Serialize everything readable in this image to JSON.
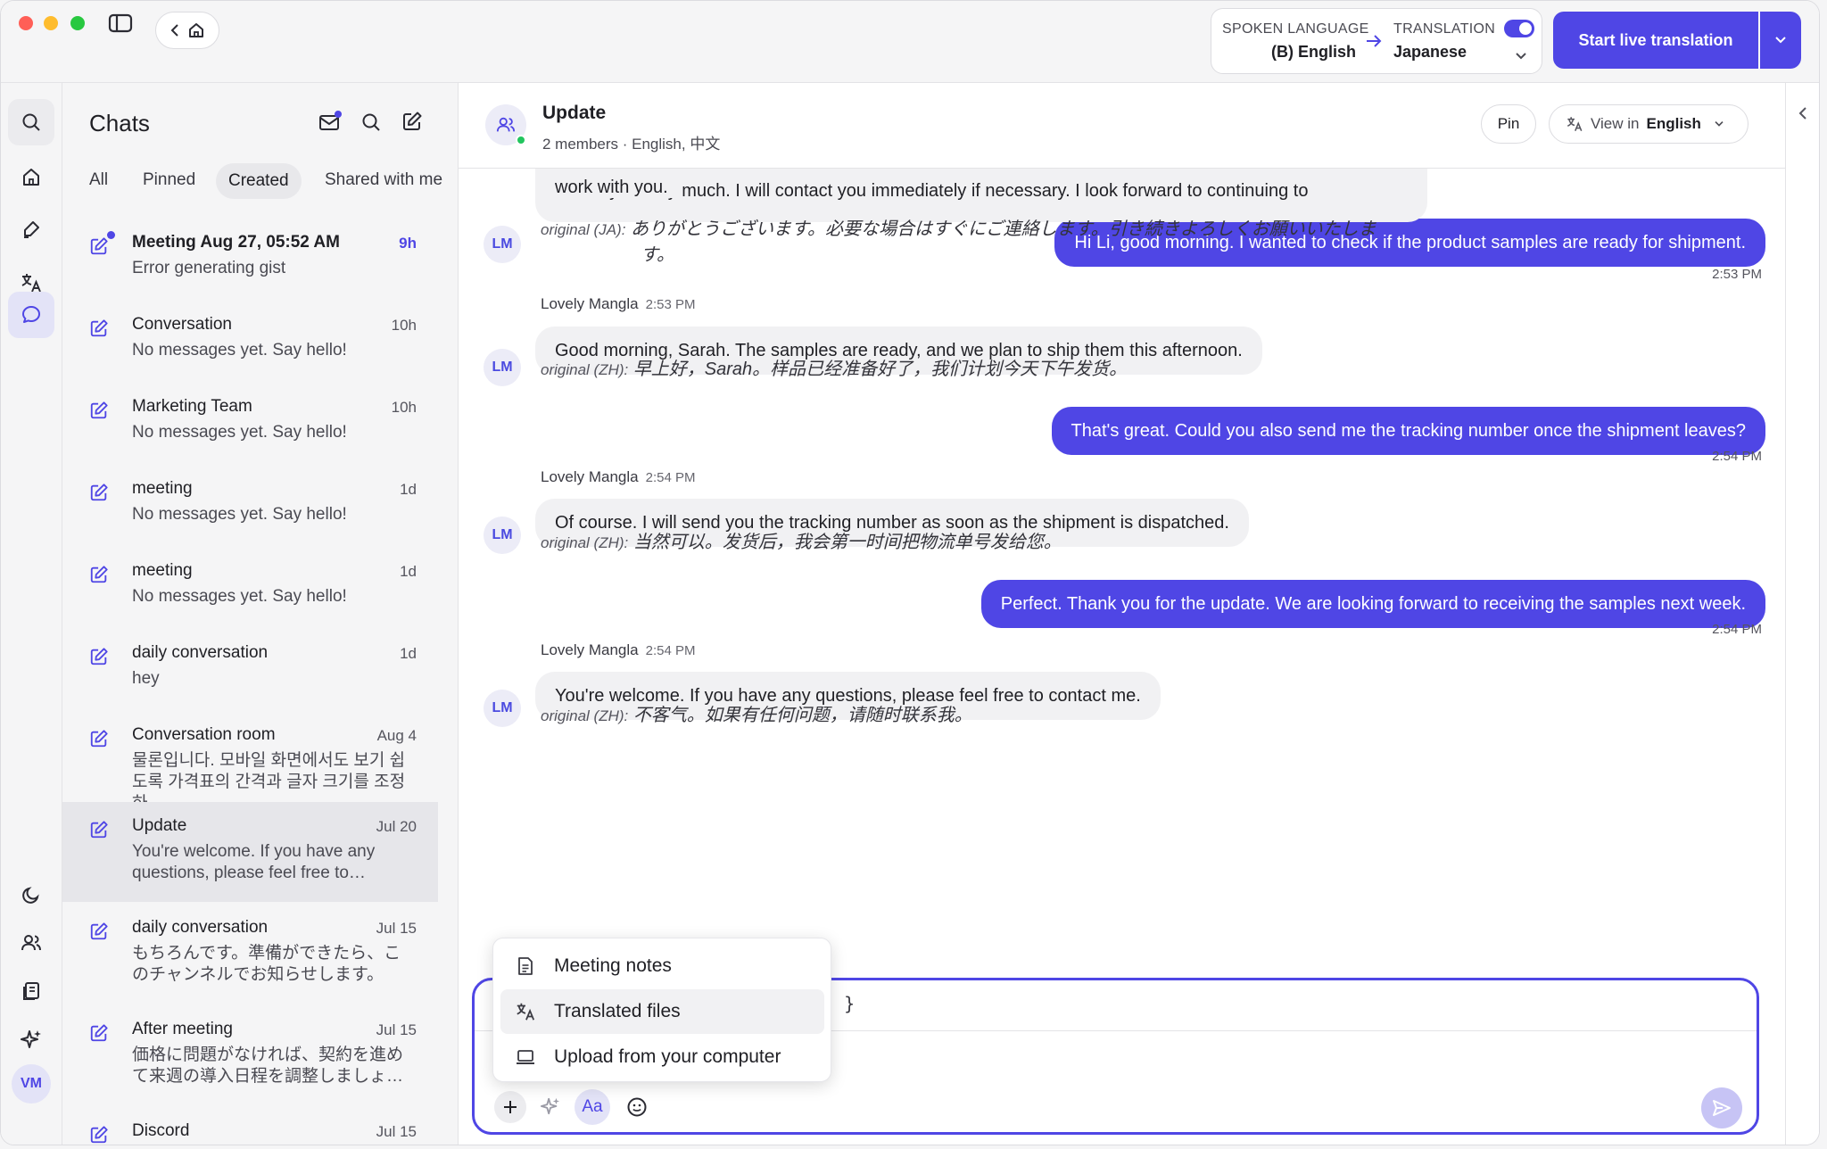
{
  "colors": {
    "accent": "#4f46e5",
    "accent_dark": "#3f37c9",
    "online": "#22c55e",
    "bubble_in": "#f1f1f3"
  },
  "titlebar": {
    "spoken_label": "SPOKEN LANGUAGE",
    "spoken_value": "(B) English",
    "translation_label": "TRANSLATION",
    "translation_value": "Japanese",
    "translation_on": true,
    "start_button": "Start live translation"
  },
  "rail": {
    "avatar": "VM"
  },
  "sidebar": {
    "title": "Chats",
    "tabs": [
      "All",
      "Pinned",
      "Created",
      "Shared with me"
    ],
    "active_tab": "Created",
    "chats": [
      {
        "title": "Meeting Aug 27, 05:52 AM",
        "time": "9h",
        "preview": "Error generating gist",
        "bold": true,
        "unread": true
      },
      {
        "title": "Conversation",
        "time": "10h",
        "preview": "No messages yet. Say hello!"
      },
      {
        "title": "Marketing Team",
        "time": "10h",
        "preview": "No messages yet. Say hello!"
      },
      {
        "title": "meeting",
        "time": "1d",
        "preview": "No messages yet. Say hello!"
      },
      {
        "title": "meeting",
        "time": "1d",
        "preview": "No messages yet. Say hello!"
      },
      {
        "title": "daily conversation",
        "time": "1d",
        "preview": "hey"
      },
      {
        "title": "Conversation room",
        "time": "Aug 4",
        "preview": "물론입니다. 모바일 화면에서도 보기 쉽도록 가격표의 간격과 글자 크기를 조정하…"
      },
      {
        "title": "Update",
        "time": "Jul 20",
        "preview": "You're welcome. If you have any questions, please feel free to…",
        "selected": true
      },
      {
        "title": "daily conversation",
        "time": "Jul 15",
        "preview": "もちろんです。準備ができたら、このチャンネルでお知らせします。"
      },
      {
        "title": "After meeting",
        "time": "Jul 15",
        "preview": "価格に問題がなければ、契約を進めて来週の導入日程を調整しましょ…"
      },
      {
        "title": "Discord",
        "time": "Jul 15",
        "preview": ""
      }
    ]
  },
  "chat": {
    "title": "Update",
    "subtitle": "2 members · English, 中文",
    "pin": "Pin",
    "view_in_label": "View in",
    "view_in_value": "English",
    "top_partial": "Thank you very much. I will contact you immediately if necessary. I look forward to continuing to",
    "top_partial2": "work with you.",
    "top_orig_label": "original (JA):",
    "top_orig_1": "ありがとうございます。必要な場合はすぐにご連絡します。引き続きよろしくお願いいたしま",
    "top_orig_2": "す。",
    "avatar": "LM",
    "messages": [
      {
        "out": "Hi Li, good morning. I wanted to check if the product samples are ready for shipment.",
        "time": "2:53 PM"
      },
      {
        "sender": "Lovely Mangla",
        "time": "2:53 PM",
        "text": "Good morning, Sarah. The samples are ready, and we plan to ship them this afternoon.",
        "orig_label": "original (ZH):",
        "orig": "早上好，Sarah。样品已经准备好了，我们计划今天下午发货。"
      },
      {
        "out": "That's great. Could you also send me the tracking number once the shipment leaves?",
        "time": "2:54 PM"
      },
      {
        "sender": "Lovely Mangla",
        "time": "2:54 PM",
        "text": "Of course. I will send you the tracking number as soon as the shipment is dispatched.",
        "orig_label": "original (ZH):",
        "orig": "当然可以。发货后，我会第一时间把物流单号发给您。"
      },
      {
        "out": "Perfect. Thank you for the update. We are looking forward to receiving the samples next week.",
        "time": "2:54 PM"
      },
      {
        "sender": "Lovely Mangla",
        "time": "2:54 PM",
        "text": "You're welcome. If you have any questions, please feel free to contact me.",
        "orig_label": "original (ZH):",
        "orig": "不客气。如果有任何问题，请随时联系我。"
      }
    ]
  },
  "composer": {
    "braces": "{ }",
    "format_label": "Aa"
  },
  "menu": {
    "items": [
      "Meeting notes",
      "Translated files",
      "Upload from your computer"
    ],
    "hover_index": 1
  }
}
